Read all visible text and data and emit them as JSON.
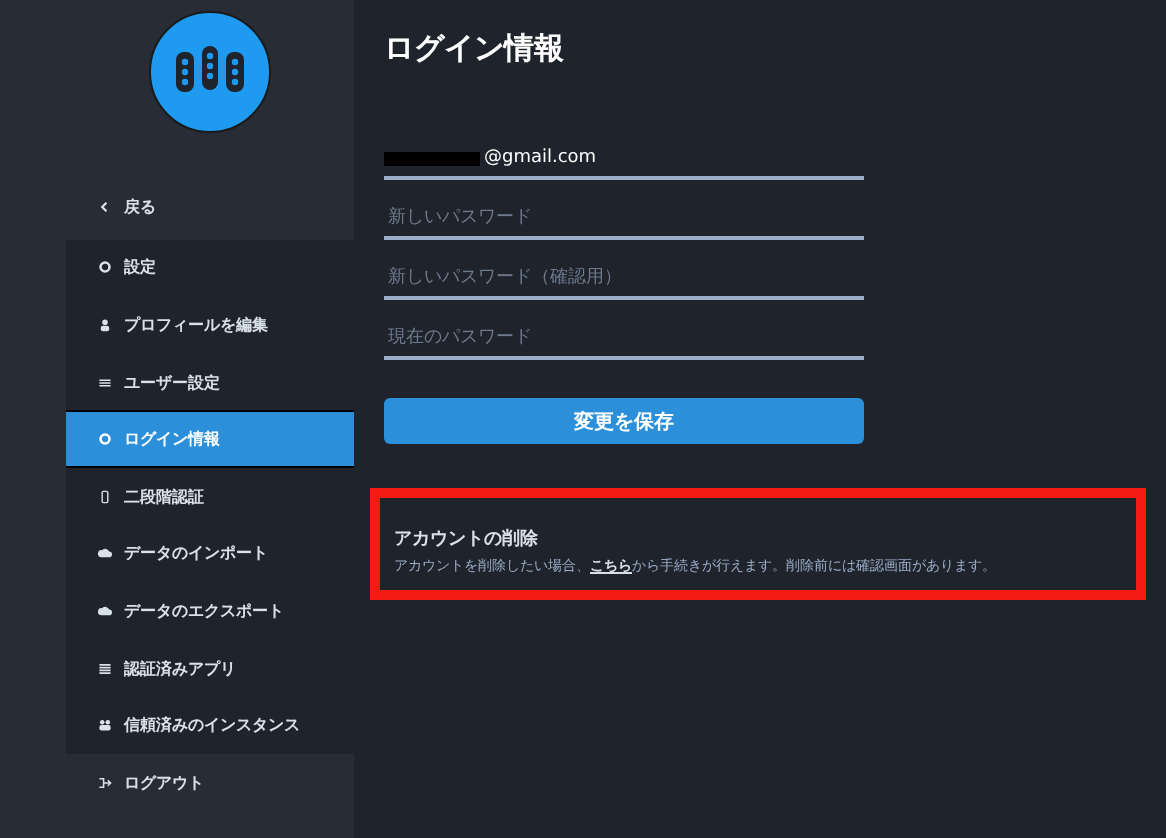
{
  "sidebar": {
    "items": [
      {
        "label": "戻る",
        "kind": "plain",
        "selected": false
      },
      {
        "label": "設定",
        "kind": "header",
        "selected": false
      },
      {
        "label": "プロフィールを編集",
        "kind": "item",
        "selected": false
      },
      {
        "label": "ユーザー設定",
        "kind": "item",
        "selected": false
      },
      {
        "label": "ログイン情報",
        "kind": "item",
        "selected": true
      },
      {
        "label": "二段階認証",
        "kind": "item",
        "selected": false
      },
      {
        "label": "データのインポート",
        "kind": "item",
        "selected": false
      },
      {
        "label": "データのエクスポート",
        "kind": "item",
        "selected": false
      },
      {
        "label": "認証済みアプリ",
        "kind": "item",
        "selected": false
      },
      {
        "label": "信頼済みのインスタンス",
        "kind": "item",
        "selected": false
      },
      {
        "label": "ログアウト",
        "kind": "plain",
        "selected": false
      }
    ]
  },
  "main": {
    "title": "ログイン情報",
    "fields": [
      {
        "value": "@gmail.com",
        "redacted": true
      },
      {
        "placeholder": "新しいパスワード"
      },
      {
        "placeholder": "新しいパスワード（確認用）"
      },
      {
        "placeholder": "現在のパスワード"
      }
    ],
    "save_button": "変更を保存",
    "delete_section": {
      "title": "アカウントの削除",
      "text": "アカウントを削除したい場合、",
      "link": "こちら",
      "text_after": "から手続きが行えます。削除前には確認画面があります。",
      "highlighted": true
    }
  }
}
